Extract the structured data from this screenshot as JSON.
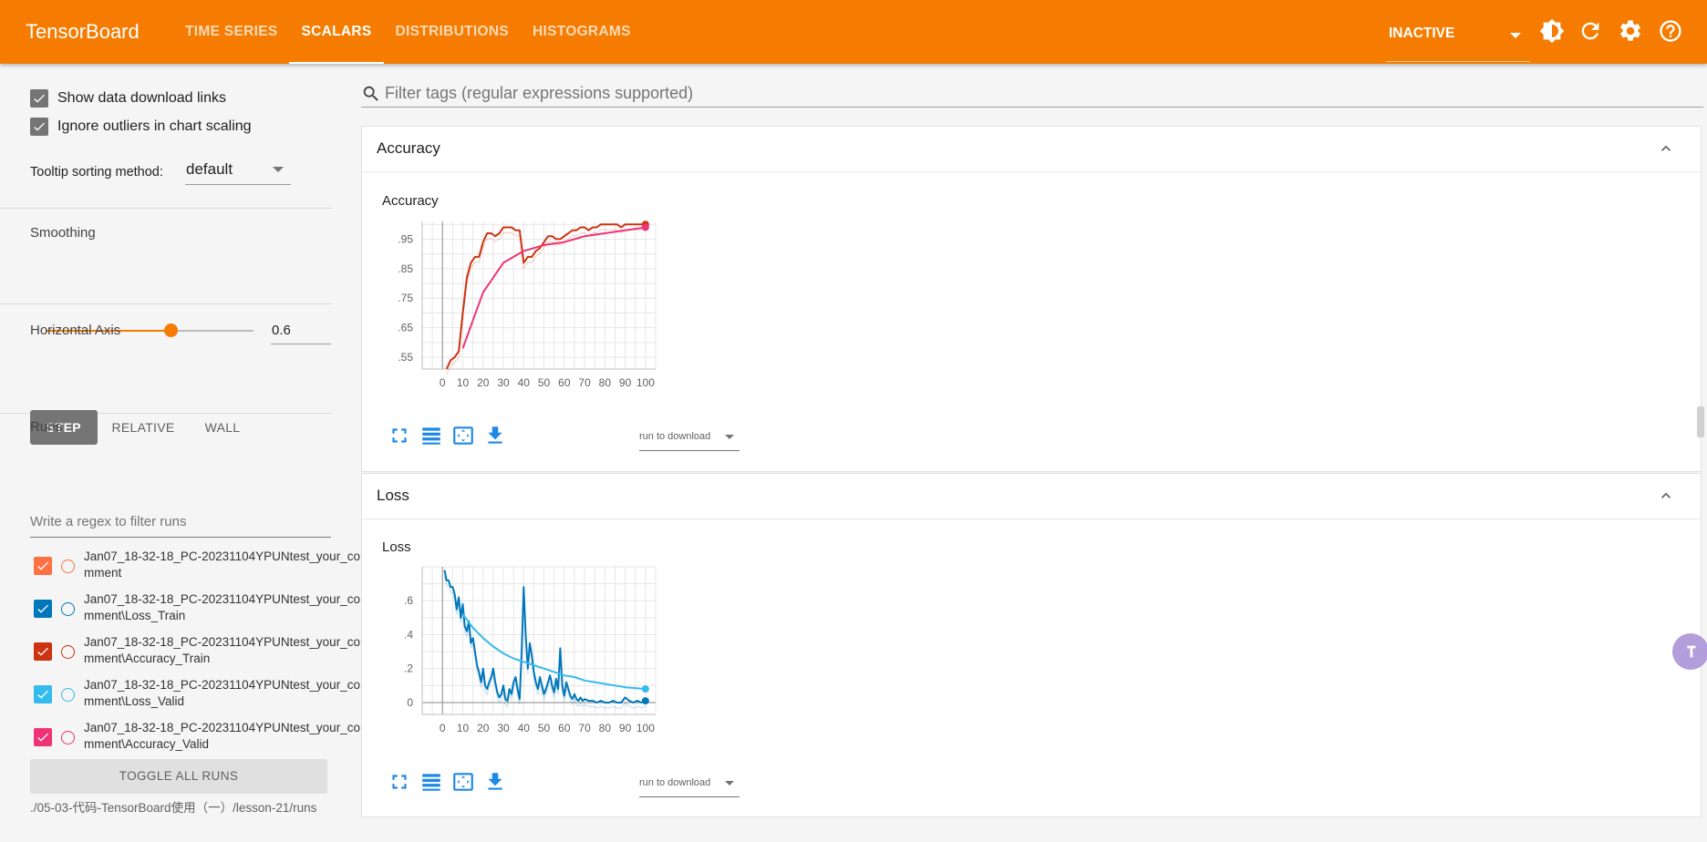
{
  "app": {
    "title": "TensorBoard"
  },
  "tabs": [
    {
      "label": "TIME SERIES"
    },
    {
      "label": "SCALARS"
    },
    {
      "label": "DISTRIBUTIONS"
    },
    {
      "label": "HISTOGRAMS"
    }
  ],
  "reload": {
    "value": "INACTIVE"
  },
  "settings": {
    "show_download_label": "Show data download links",
    "show_download": true,
    "ignore_outliers_label": "Ignore outliers in chart scaling",
    "ignore_outliers": true,
    "tooltip_label": "Tooltip sorting method:",
    "tooltip_value": "default",
    "smoothing_label": "Smoothing",
    "smoothing_value": "0.6",
    "smoothing_fraction": 0.6,
    "axis_label": "Horizontal Axis",
    "axis_options": [
      "STEP",
      "RELATIVE",
      "WALL"
    ],
    "axis_selected": "STEP"
  },
  "runs": {
    "title": "Runs",
    "filter_placeholder": "Write a regex to filter runs",
    "items": [
      {
        "name": "Jan07_18-32-18_PC-20231104YPUNtest_your_comment",
        "color": "#ff7043",
        "checked": true
      },
      {
        "name": "Jan07_18-32-18_PC-20231104YPUNtest_your_comment\\Loss_Train",
        "color": "#0077bb",
        "checked": true
      },
      {
        "name": "Jan07_18-32-18_PC-20231104YPUNtest_your_comment\\Accuracy_Train",
        "color": "#cc3311",
        "checked": true
      },
      {
        "name": "Jan07_18-32-18_PC-20231104YPUNtest_your_comment\\Loss_Valid",
        "color": "#33bbee",
        "checked": true
      },
      {
        "name": "Jan07_18-32-18_PC-20231104YPUNtest_your_comment\\Accuracy_Valid",
        "color": "#ee3377",
        "checked": true
      }
    ],
    "toggle_label": "TOGGLE ALL RUNS",
    "logdir": "./05-03-代码-TensorBoard使用（一）/lesson-21/runs"
  },
  "main": {
    "filter_placeholder": "Filter tags (regular expressions supported)",
    "download_placeholder": "run to download"
  },
  "cards": [
    {
      "header": "Accuracy",
      "chart_title": "Accuracy"
    },
    {
      "header": "Loss",
      "chart_title": "Loss"
    }
  ],
  "chart_data": [
    {
      "type": "line",
      "title": "Accuracy",
      "xlabel": "",
      "ylabel": "",
      "xlim": [
        -10,
        105
      ],
      "ylim": [
        0.51,
        1.01
      ],
      "x_ticks": [
        0,
        10,
        20,
        30,
        40,
        50,
        60,
        70,
        80,
        90,
        100
      ],
      "y_ticks": [
        0.55,
        0.65,
        0.75,
        0.85,
        0.95
      ],
      "grid": true,
      "series": [
        {
          "name": "Accuracy_Train",
          "color": "#cc3311",
          "x": [
            2,
            4,
            6,
            8,
            10,
            12,
            14,
            16,
            18,
            20,
            22,
            24,
            26,
            28,
            30,
            32,
            34,
            36,
            38,
            40,
            42,
            44,
            46,
            48,
            50,
            52,
            54,
            56,
            58,
            60,
            62,
            64,
            66,
            68,
            70,
            72,
            74,
            76,
            78,
            80,
            82,
            84,
            86,
            88,
            90,
            92,
            94,
            96,
            98,
            100
          ],
          "y": [
            0.51,
            0.54,
            0.55,
            0.57,
            0.7,
            0.82,
            0.87,
            0.89,
            0.89,
            0.94,
            0.97,
            0.97,
            0.96,
            0.97,
            0.99,
            0.99,
            0.99,
            0.98,
            0.98,
            0.87,
            0.89,
            0.89,
            0.91,
            0.92,
            0.94,
            0.96,
            0.96,
            0.95,
            0.95,
            0.96,
            0.97,
            0.98,
            0.98,
            0.99,
            0.99,
            0.98,
            0.99,
            0.99,
            1.0,
            1.0,
            1.0,
            1.0,
            1.0,
            0.99,
            1.0,
            1.0,
            1.0,
            1.0,
            1.0,
            1.0
          ]
        },
        {
          "name": "Accuracy_Valid",
          "color": "#ee3377",
          "x": [
            10,
            20,
            30,
            40,
            50,
            60,
            70,
            80,
            90,
            100
          ],
          "y": [
            0.58,
            0.77,
            0.87,
            0.91,
            0.93,
            0.94,
            0.96,
            0.97,
            0.98,
            0.99
          ]
        }
      ]
    },
    {
      "type": "line",
      "title": "Loss",
      "xlabel": "",
      "ylabel": "",
      "xlim": [
        -10,
        105
      ],
      "ylim": [
        -0.07,
        0.8
      ],
      "x_ticks": [
        0,
        10,
        20,
        30,
        40,
        50,
        60,
        70,
        80,
        90,
        100
      ],
      "y_ticks": [
        0,
        0.2,
        0.4,
        0.6
      ],
      "grid": true,
      "series": [
        {
          "name": "Loss_Train",
          "color": "#0077bb",
          "x": [
            1,
            2,
            3,
            4,
            5,
            6,
            7,
            8,
            9,
            10,
            11,
            12,
            13,
            14,
            15,
            16,
            17,
            18,
            19,
            20,
            21,
            22,
            23,
            24,
            25,
            26,
            27,
            28,
            29,
            30,
            31,
            32,
            33,
            34,
            35,
            36,
            37,
            38,
            39,
            40,
            41,
            42,
            43,
            44,
            45,
            46,
            47,
            48,
            49,
            50,
            51,
            52,
            53,
            54,
            55,
            56,
            57,
            58,
            59,
            60,
            61,
            62,
            63,
            64,
            65,
            66,
            67,
            68,
            69,
            70,
            72,
            74,
            76,
            78,
            80,
            82,
            84,
            86,
            88,
            90,
            92,
            94,
            96,
            98,
            100
          ],
          "y": [
            0.78,
            0.72,
            0.72,
            0.68,
            0.68,
            0.64,
            0.55,
            0.62,
            0.5,
            0.58,
            0.45,
            0.42,
            0.48,
            0.35,
            0.38,
            0.3,
            0.22,
            0.18,
            0.12,
            0.2,
            0.1,
            0.08,
            0.12,
            0.15,
            0.2,
            0.12,
            0.06,
            0.03,
            0.05,
            0.1,
            0.02,
            0.01,
            0.08,
            0.05,
            0.12,
            0.15,
            0.08,
            0.02,
            0.3,
            0.68,
            0.4,
            0.2,
            0.35,
            0.28,
            0.18,
            0.12,
            0.08,
            0.15,
            0.1,
            0.05,
            0.08,
            0.12,
            0.16,
            0.1,
            0.06,
            0.14,
            0.08,
            0.32,
            0.1,
            0.04,
            0.12,
            0.08,
            0.04,
            0.02,
            0.05,
            0.02,
            0.01,
            0.03,
            0.01,
            0.02,
            0.01,
            0.01,
            0.0,
            0.01,
            0.0,
            0.0,
            0.01,
            0.0,
            0.0,
            0.03,
            0.01,
            0.0,
            0.01,
            0.0,
            0.01
          ]
        },
        {
          "name": "Loss_Valid",
          "color": "#33bbee",
          "x": [
            10,
            15,
            20,
            25,
            30,
            35,
            40,
            45,
            50,
            55,
            60,
            65,
            70,
            75,
            80,
            85,
            90,
            95,
            100
          ],
          "y": [
            0.52,
            0.44,
            0.38,
            0.33,
            0.29,
            0.26,
            0.24,
            0.22,
            0.2,
            0.18,
            0.16,
            0.15,
            0.13,
            0.12,
            0.11,
            0.1,
            0.09,
            0.085,
            0.08
          ]
        }
      ]
    }
  ]
}
